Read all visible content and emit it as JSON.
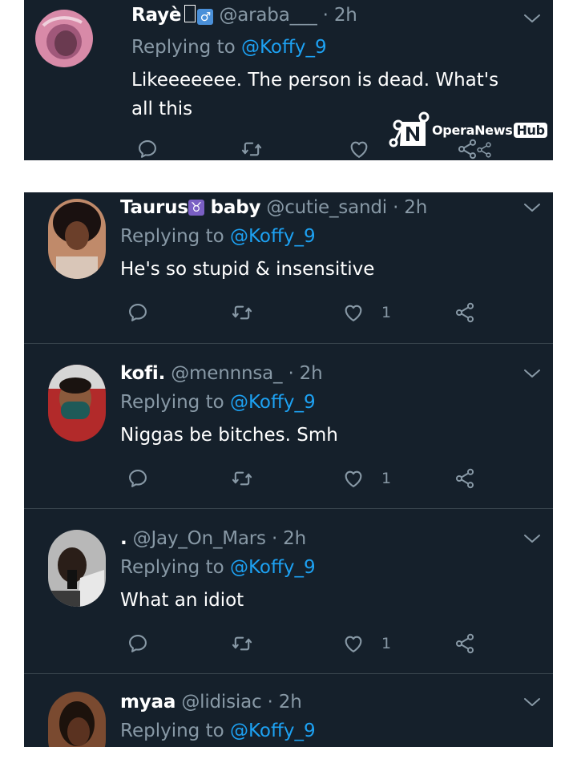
{
  "tweets": [
    {
      "display_name": "Rayè",
      "handle": "@araba___",
      "time": "· 2h",
      "reply_prefix": "Replying to",
      "reply_to": "@Koffy_9",
      "text": "Likeeeeeee. The person is dead. What's all this",
      "likes": ""
    },
    {
      "display_name": "Taurus",
      "zodiac": "♉",
      "display_name_suffix": "baby",
      "handle": "@cutie_sandi",
      "time": "· 2h",
      "reply_prefix": "Replying to",
      "reply_to": "@Koffy_9",
      "text": "He's so stupid & insensitive",
      "likes": "1"
    },
    {
      "display_name": "kofi.",
      "handle": "@mennnsa_",
      "time": "· 2h",
      "reply_prefix": "Replying to",
      "reply_to": "@Koffy_9",
      "text": "Niggas be bitches. Smh",
      "likes": "1"
    },
    {
      "display_name": ".",
      "handle": "@Jay_On_Mars",
      "time": "· 2h",
      "reply_prefix": "Replying to",
      "reply_to": "@Koffy_9",
      "text": "What an idiot",
      "likes": "1"
    },
    {
      "display_name": "myaa",
      "handle": "@lidisiac",
      "time": "· 2h",
      "reply_prefix": "Replying to",
      "reply_to": "@Koffy_9"
    }
  ],
  "watermark": {
    "brand": "OperaNews",
    "hub": "Hub"
  },
  "icons": [
    "reply-icon",
    "retweet-icon",
    "like-icon",
    "share-icon",
    "chevron-down-icon"
  ],
  "colors": {
    "background": "#15202b",
    "text": "#ffffff",
    "secondary": "#8899a6",
    "mention": "#1da1f2",
    "divider": "#38444d"
  }
}
